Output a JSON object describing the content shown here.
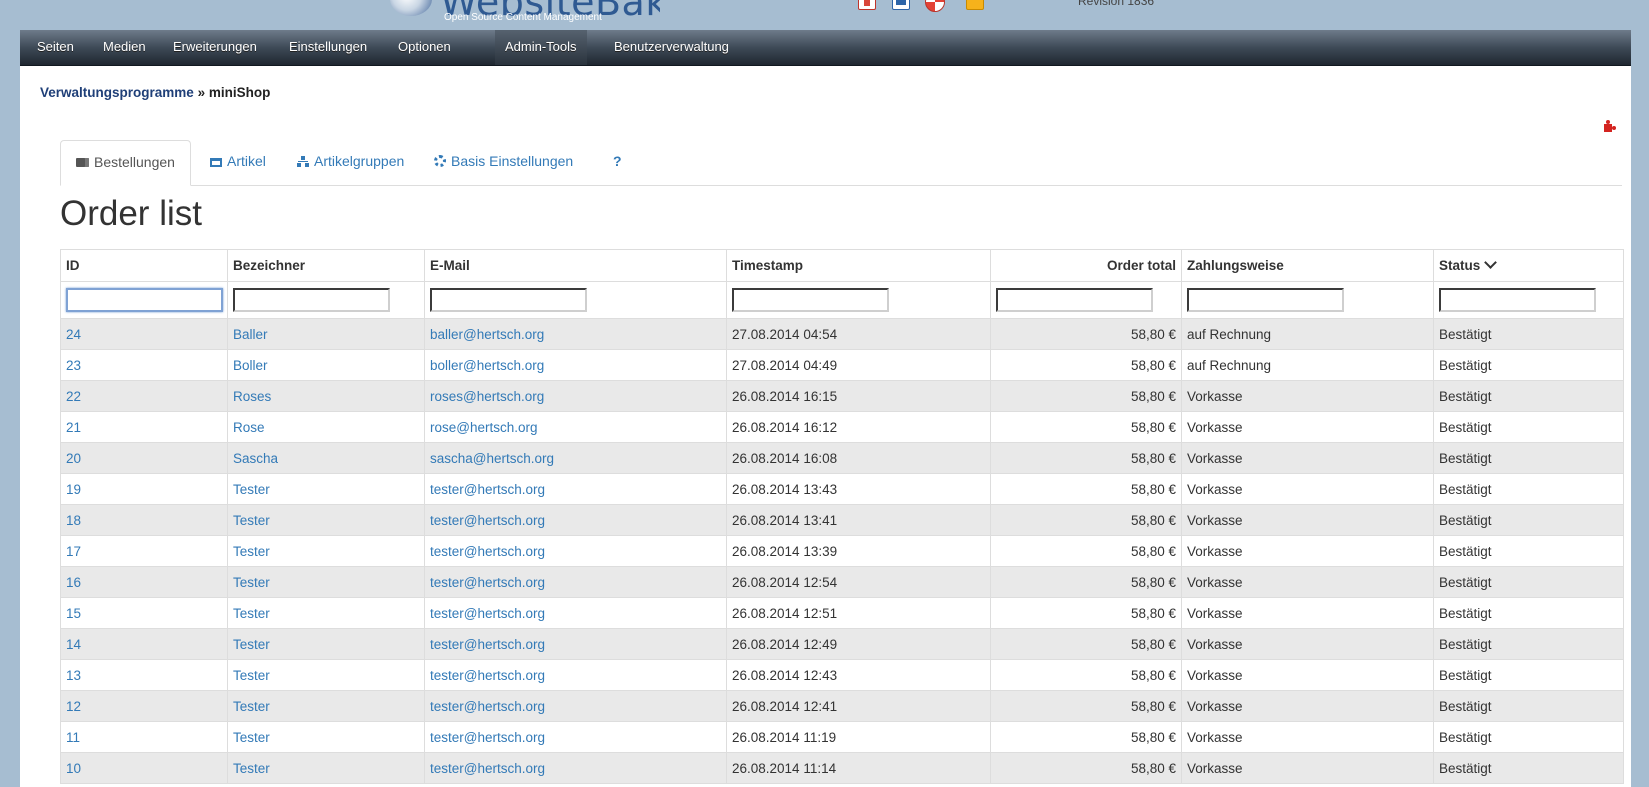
{
  "header": {
    "logo_text": "WebsiteBaker",
    "logo_subtitle": "Open Source Content Management",
    "revision": "Revision 1836"
  },
  "menu": {
    "items": [
      {
        "label": "Seiten"
      },
      {
        "label": "Medien"
      },
      {
        "label": "Erweiterungen"
      },
      {
        "label": "Einstellungen"
      },
      {
        "label": "Optionen"
      },
      {
        "label": "Admin-Tools",
        "active": true
      },
      {
        "label": "Benutzerverwaltung"
      }
    ]
  },
  "breadcrumb": {
    "parent": "Verwaltungsprogramme",
    "separator": "»",
    "current": "miniShop"
  },
  "tabs": [
    {
      "label": "Bestellungen",
      "icon": "truck-icon",
      "active": true
    },
    {
      "label": "Artikel",
      "icon": "cart-icon"
    },
    {
      "label": "Artikelgruppen",
      "icon": "sitemap-icon"
    },
    {
      "label": "Basis Einstellungen",
      "icon": "cogs-icon"
    },
    {
      "label": "?"
    }
  ],
  "page_title": "Order list",
  "table": {
    "columns": [
      {
        "label": "ID"
      },
      {
        "label": "Bezeichner"
      },
      {
        "label": "E-Mail"
      },
      {
        "label": "Timestamp"
      },
      {
        "label": "Order total"
      },
      {
        "label": "Zahlungsweise"
      },
      {
        "label": "Status"
      }
    ],
    "rows": [
      {
        "id": "24",
        "name": "Baller",
        "email": "baller@hertsch.org",
        "timestamp": "27.08.2014 04:54",
        "total": "58,80 €",
        "payment": "auf Rechnung",
        "status": "Bestätigt"
      },
      {
        "id": "23",
        "name": "Boller",
        "email": "boller@hertsch.org",
        "timestamp": "27.08.2014 04:49",
        "total": "58,80 €",
        "payment": "auf Rechnung",
        "status": "Bestätigt"
      },
      {
        "id": "22",
        "name": "Roses",
        "email": "roses@hertsch.org",
        "timestamp": "26.08.2014 16:15",
        "total": "58,80 €",
        "payment": "Vorkasse",
        "status": "Bestätigt"
      },
      {
        "id": "21",
        "name": "Rose",
        "email": "rose@hertsch.org",
        "timestamp": "26.08.2014 16:12",
        "total": "58,80 €",
        "payment": "Vorkasse",
        "status": "Bestätigt"
      },
      {
        "id": "20",
        "name": "Sascha",
        "email": "sascha@hertsch.org",
        "timestamp": "26.08.2014 16:08",
        "total": "58,80 €",
        "payment": "Vorkasse",
        "status": "Bestätigt"
      },
      {
        "id": "19",
        "name": "Tester",
        "email": "tester@hertsch.org",
        "timestamp": "26.08.2014 13:43",
        "total": "58,80 €",
        "payment": "Vorkasse",
        "status": "Bestätigt"
      },
      {
        "id": "18",
        "name": "Tester",
        "email": "tester@hertsch.org",
        "timestamp": "26.08.2014 13:41",
        "total": "58,80 €",
        "payment": "Vorkasse",
        "status": "Bestätigt"
      },
      {
        "id": "17",
        "name": "Tester",
        "email": "tester@hertsch.org",
        "timestamp": "26.08.2014 13:39",
        "total": "58,80 €",
        "payment": "Vorkasse",
        "status": "Bestätigt"
      },
      {
        "id": "16",
        "name": "Tester",
        "email": "tester@hertsch.org",
        "timestamp": "26.08.2014 12:54",
        "total": "58,80 €",
        "payment": "Vorkasse",
        "status": "Bestätigt"
      },
      {
        "id": "15",
        "name": "Tester",
        "email": "tester@hertsch.org",
        "timestamp": "26.08.2014 12:51",
        "total": "58,80 €",
        "payment": "Vorkasse",
        "status": "Bestätigt"
      },
      {
        "id": "14",
        "name": "Tester",
        "email": "tester@hertsch.org",
        "timestamp": "26.08.2014 12:49",
        "total": "58,80 €",
        "payment": "Vorkasse",
        "status": "Bestätigt"
      },
      {
        "id": "13",
        "name": "Tester",
        "email": "tester@hertsch.org",
        "timestamp": "26.08.2014 12:43",
        "total": "58,80 €",
        "payment": "Vorkasse",
        "status": "Bestätigt"
      },
      {
        "id": "12",
        "name": "Tester",
        "email": "tester@hertsch.org",
        "timestamp": "26.08.2014 12:41",
        "total": "58,80 €",
        "payment": "Vorkasse",
        "status": "Bestätigt"
      },
      {
        "id": "11",
        "name": "Tester",
        "email": "tester@hertsch.org",
        "timestamp": "26.08.2014 11:19",
        "total": "58,80 €",
        "payment": "Vorkasse",
        "status": "Bestätigt"
      },
      {
        "id": "10",
        "name": "Tester",
        "email": "tester@hertsch.org",
        "timestamp": "26.08.2014 11:14",
        "total": "58,80 €",
        "payment": "Vorkasse",
        "status": "Bestätigt"
      }
    ]
  },
  "colors": {
    "link": "#337ab7",
    "background": "#a6bdd1",
    "row_alt": "#e9e9e9"
  }
}
